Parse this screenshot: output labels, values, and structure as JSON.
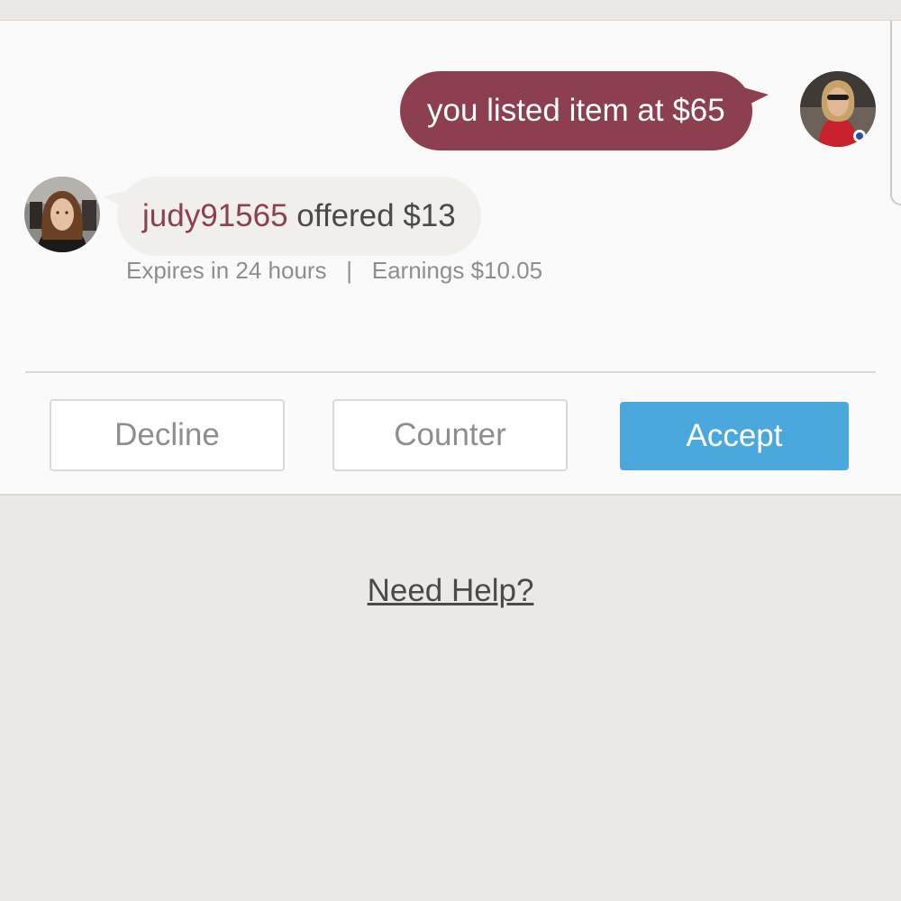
{
  "conversation": {
    "seller_message": "you listed item at $65",
    "offer": {
      "buyer_username": "judy91565",
      "offer_text": "offered $13",
      "expires": "Expires in 24 hours",
      "separator": "|",
      "earnings": "Earnings $10.05"
    }
  },
  "actions": {
    "decline_label": "Decline",
    "counter_label": "Counter",
    "accept_label": "Accept"
  },
  "footer": {
    "help_label": "Need Help?"
  },
  "colors": {
    "brand": "#8c3f4f",
    "accept": "#4aa8dc",
    "background": "#ebe8e5"
  },
  "icons": {
    "seller_avatar": "seller-avatar-photo",
    "buyer_avatar": "buyer-avatar-photo"
  }
}
